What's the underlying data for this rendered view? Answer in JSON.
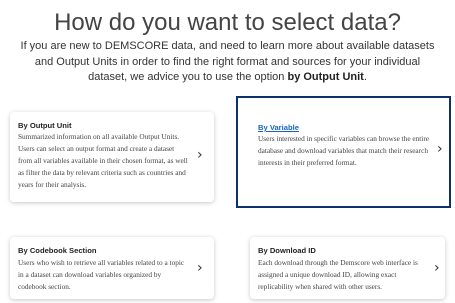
{
  "page": {
    "title": "How do you want to select data?",
    "intro_text": "If you are new to DEMSCORE data, and need to learn more about available datasets and Output Units in order to find the right format and sources for your individual dataset, we advice you to use the option",
    "intro_emphasis": "by Output Unit"
  },
  "options": [
    {
      "title": "By Output Unit",
      "description": "Summarized information on all available Output Units. Users can select an output format and create a dataset from all variables available in their chosen format, as well as filter the data by relevant criteria such as countries and years for their analysis.",
      "chevron": "›"
    },
    {
      "title": "By Variable",
      "description": "Users interested in specific variables can browse the entire database and download variables that match their research interests in their preferred format.",
      "chevron": "›"
    },
    {
      "title": "By Codebook Section",
      "description": "Users who wish to retrieve all variables related to a topic in a dataset can download variables organized by codebook section.",
      "chevron": "›"
    },
    {
      "title": "By Download ID",
      "description": "Each download through the Demscore web interface is assigned a unique download ID, allowing exact replicability when shared with other users.",
      "chevron": "›"
    }
  ]
}
